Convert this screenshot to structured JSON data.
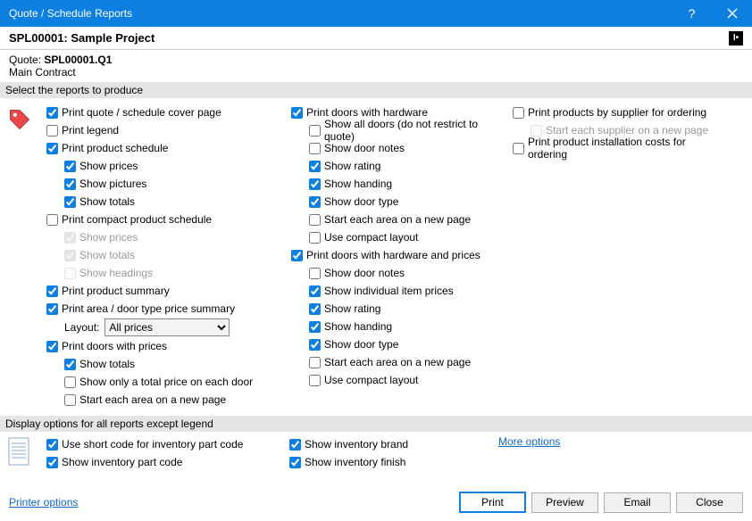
{
  "window": {
    "title": "Quote / Schedule Reports"
  },
  "project": {
    "code": "SPL00001",
    "name": "Sample Project",
    "display": "SPL00001: Sample Project"
  },
  "quote": {
    "label": "Quote:",
    "code": "SPL00001.Q1",
    "sub": "Main Contract"
  },
  "section_select": "Select the reports to produce",
  "section_display": "Display options for all reports except legend",
  "layout_label": "Layout:",
  "layout_options": [
    "All prices"
  ],
  "layout_value": "All prices",
  "col1": {
    "cover": {
      "label": "Print quote / schedule cover page",
      "checked": true
    },
    "legend": {
      "label": "Print legend",
      "checked": false
    },
    "schedule": {
      "label": "Print product schedule",
      "checked": true
    },
    "schedule_prices": {
      "label": "Show prices",
      "checked": true
    },
    "schedule_pictures": {
      "label": "Show pictures",
      "checked": true
    },
    "schedule_totals": {
      "label": "Show totals",
      "checked": true
    },
    "compact": {
      "label": "Print compact product schedule",
      "checked": false
    },
    "compact_prices": {
      "label": "Show prices",
      "checked": true,
      "disabled": true
    },
    "compact_totals": {
      "label": "Show totals",
      "checked": true,
      "disabled": true
    },
    "compact_headings": {
      "label": "Show headings",
      "checked": false,
      "disabled": true
    },
    "summary": {
      "label": "Print product summary",
      "checked": true
    },
    "area_summary": {
      "label": "Print area / door type price summary",
      "checked": true
    },
    "doors_prices": {
      "label": "Print doors with prices",
      "checked": true
    },
    "dp_totals": {
      "label": "Show totals",
      "checked": true
    },
    "dp_only_total": {
      "label": "Show only a total price on each door",
      "checked": false
    },
    "dp_newpage": {
      "label": "Start each area on a new page",
      "checked": false
    }
  },
  "col2": {
    "doors_hw": {
      "label": "Print doors with hardware",
      "checked": true
    },
    "dh_all": {
      "label": "Show all doors (do not restrict to quote)",
      "checked": false
    },
    "dh_notes": {
      "label": "Show door notes",
      "checked": false
    },
    "dh_rating": {
      "label": "Show rating",
      "checked": true
    },
    "dh_handing": {
      "label": "Show handing",
      "checked": true
    },
    "dh_type": {
      "label": "Show door type",
      "checked": true
    },
    "dh_newpage": {
      "label": "Start each area on a new page",
      "checked": false
    },
    "dh_compact": {
      "label": "Use compact layout",
      "checked": false
    },
    "doors_hwp": {
      "label": "Print doors with hardware and prices",
      "checked": true
    },
    "dhp_notes": {
      "label": "Show door notes",
      "checked": false
    },
    "dhp_item_prices": {
      "label": "Show individual item prices",
      "checked": true
    },
    "dhp_rating": {
      "label": "Show rating",
      "checked": true
    },
    "dhp_handing": {
      "label": "Show handing",
      "checked": true
    },
    "dhp_type": {
      "label": "Show door type",
      "checked": true
    },
    "dhp_newpage": {
      "label": "Start each area on a new page",
      "checked": false
    },
    "dhp_compact": {
      "label": "Use compact layout",
      "checked": false
    }
  },
  "col3": {
    "supplier": {
      "label": "Print products by supplier for ordering",
      "checked": false
    },
    "supplier_newpage": {
      "label": "Start each supplier on a new page",
      "checked": false,
      "disabled": true
    },
    "install": {
      "label": "Print product installation costs for ordering",
      "checked": false
    }
  },
  "display": {
    "shortcode": {
      "label": "Use short code for inventory part code",
      "checked": true
    },
    "partcode": {
      "label": "Show inventory part code",
      "checked": true
    },
    "brand": {
      "label": "Show inventory brand",
      "checked": true
    },
    "finish": {
      "label": "Show inventory finish",
      "checked": true
    }
  },
  "links": {
    "more": "More options",
    "printer": "Printer options"
  },
  "buttons": {
    "print": "Print",
    "preview": "Preview",
    "email": "Email",
    "close": "Close"
  }
}
